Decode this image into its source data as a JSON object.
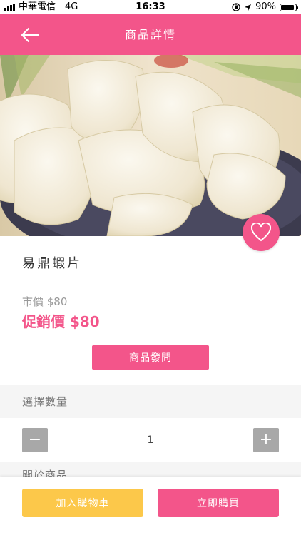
{
  "status_bar": {
    "carrier": "中華電信",
    "network": "4G",
    "time": "16:33",
    "battery": "90%",
    "battery_level": 0.9
  },
  "header": {
    "title": "商品詳情",
    "back_icon": "arrow-left-icon"
  },
  "product": {
    "name": "易鼎蝦片",
    "market_price": "市價 $80",
    "promo_price": "促銷價 $80",
    "favorite_icon": "heart-outline-icon"
  },
  "inquiry_button": "商品發問",
  "quantity": {
    "section_label": "選擇數量",
    "value": "1",
    "minus_label": "−",
    "plus_label": "+"
  },
  "related": {
    "section_label": "關於商品"
  },
  "bottom_bar": {
    "add_to_cart": "加入購物車",
    "buy_now": "立即購買"
  },
  "colors": {
    "accent": "#f3558a",
    "cart_button": "#fcc84a",
    "quantity_button": "#a8a8a8"
  }
}
